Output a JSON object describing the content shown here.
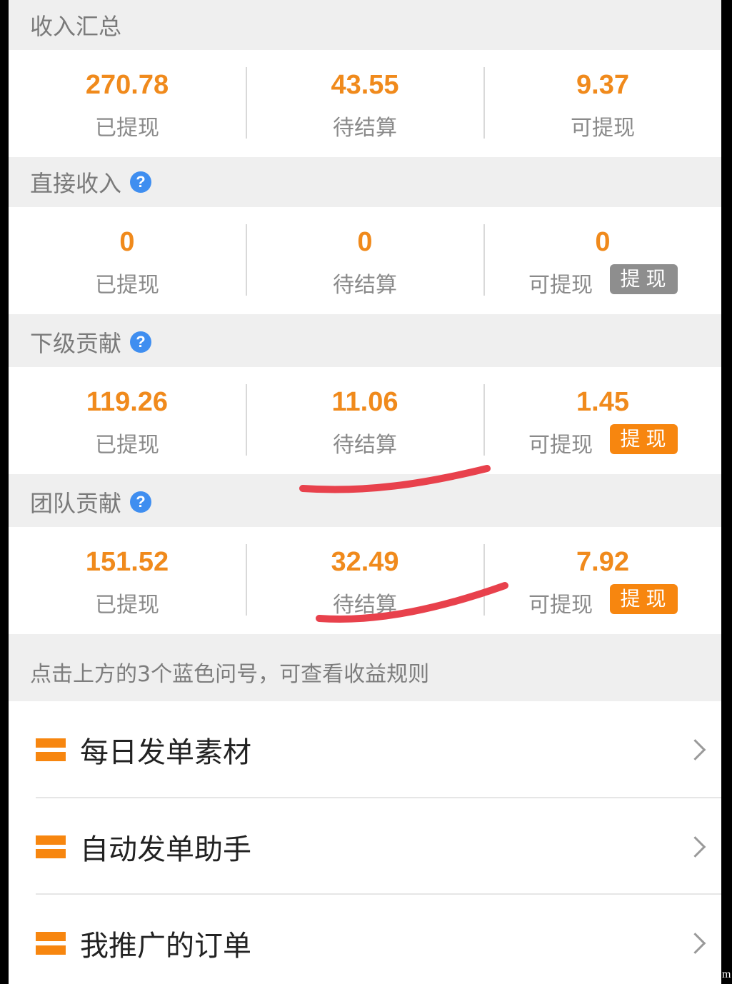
{
  "summary": {
    "title": "收入汇总",
    "withdrawn": "270.78",
    "withdrawn_label": "已提现",
    "pending": "43.55",
    "pending_label": "待结算",
    "available": "9.37",
    "available_label": "可提现"
  },
  "direct": {
    "title": "直接收入",
    "withdrawn": "0",
    "withdrawn_label": "已提现",
    "pending": "0",
    "pending_label": "待结算",
    "available": "0",
    "available_label": "可提现",
    "button": "提现"
  },
  "sub": {
    "title": "下级贡献",
    "withdrawn": "119.26",
    "withdrawn_label": "已提现",
    "pending": "11.06",
    "pending_label": "待结算",
    "available": "1.45",
    "available_label": "可提现",
    "button": "提现"
  },
  "team": {
    "title": "团队贡献",
    "withdrawn": "151.52",
    "withdrawn_label": "已提现",
    "pending": "32.49",
    "pending_label": "待结算",
    "available": "7.92",
    "available_label": "可提现",
    "button": "提现"
  },
  "help_icon": "?",
  "tip": "点击上方的3个蓝色问号，可查看收益规则",
  "menu": [
    {
      "label": "每日发单素材",
      "icon": "list-icon"
    },
    {
      "label": "自动发单助手",
      "icon": "list-icon"
    },
    {
      "label": "我推广的订单",
      "icon": "list-icon"
    }
  ],
  "corner_text": "m",
  "colors": {
    "accent": "#f08a1c",
    "button_orange": "#f7860f",
    "button_gray": "#8e8e8e",
    "help_blue": "#3f8ef0",
    "annotation_red": "#e8414c"
  }
}
